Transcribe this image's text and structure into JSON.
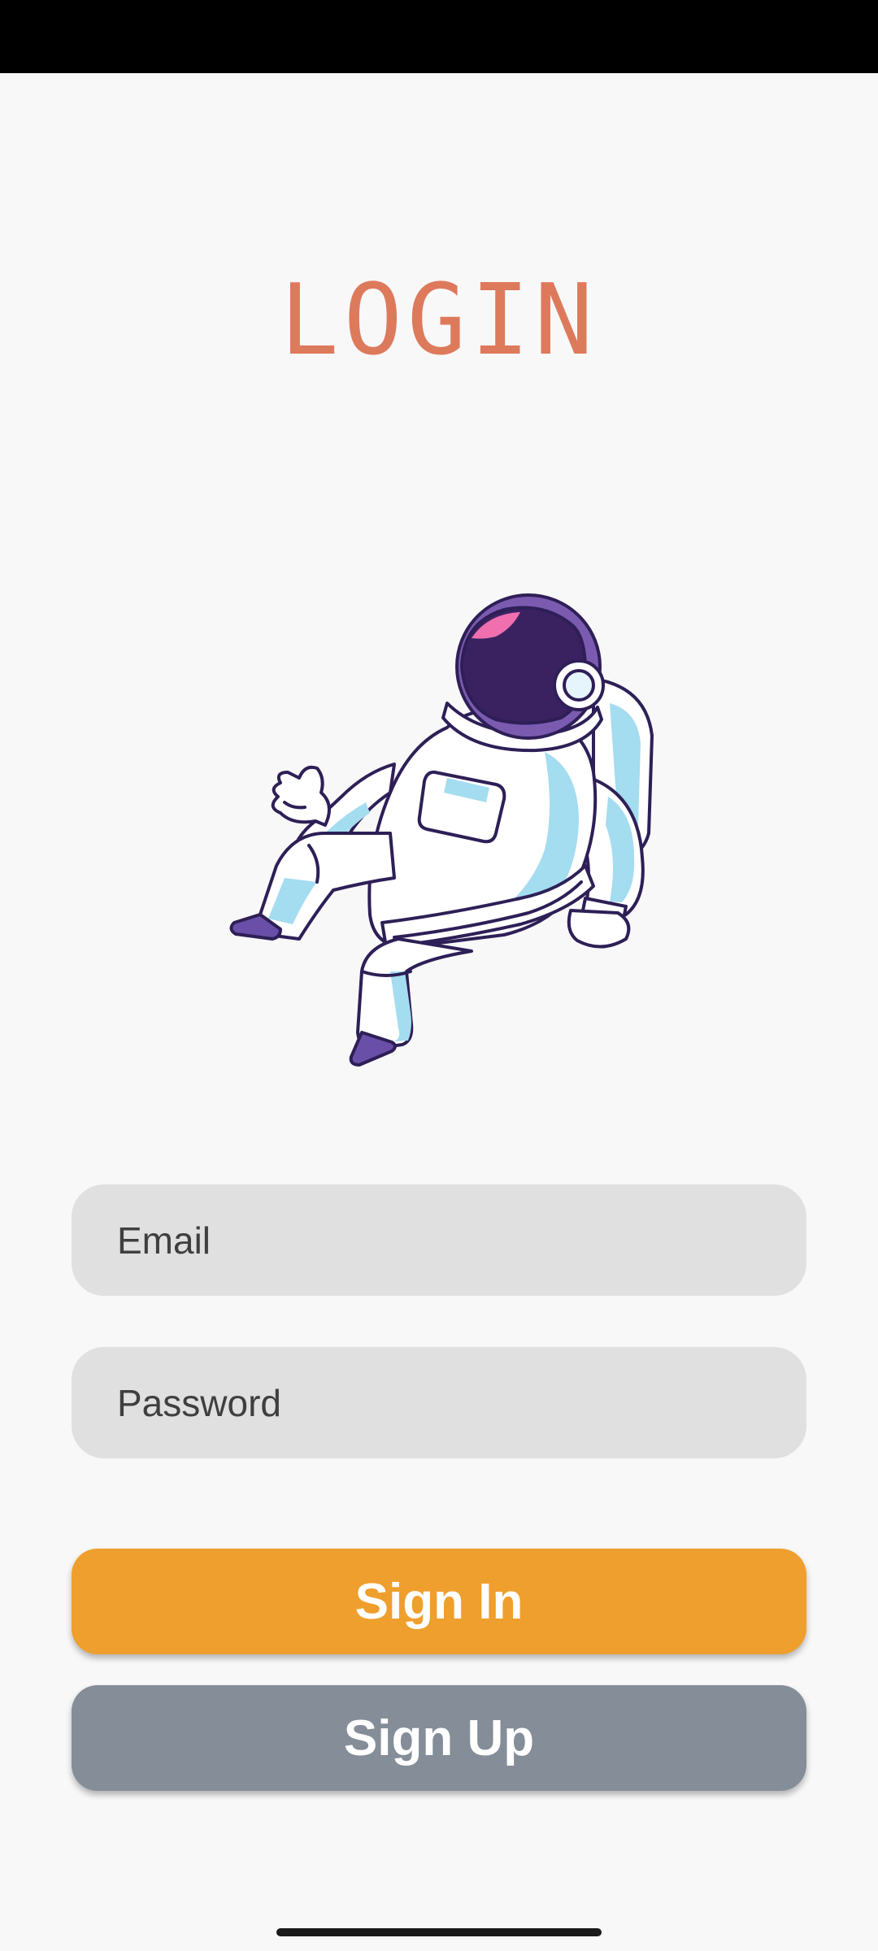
{
  "screen": {
    "title": "LOGIN",
    "illustration": "astronaut-illustration"
  },
  "form": {
    "email": {
      "placeholder": "Email",
      "value": ""
    },
    "password": {
      "placeholder": "Password",
      "value": ""
    }
  },
  "actions": {
    "sign_in_label": "Sign In",
    "sign_up_label": "Sign Up"
  },
  "colors": {
    "title": "#dd7a5c",
    "sign_in": "#ef9f2d",
    "sign_up": "#848d98",
    "field_bg": "#e0e0e0",
    "background": "#f8f8f8"
  }
}
